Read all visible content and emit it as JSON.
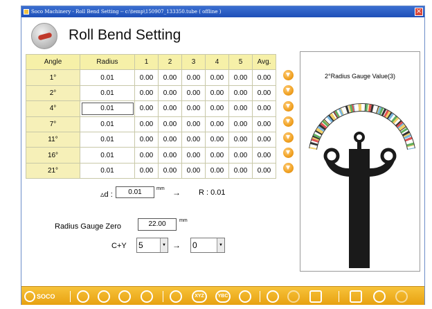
{
  "window": {
    "title": "Soco Machinery - Roll Bend Setting  -- c:\\temp\\150907_133350.tube ( offline )",
    "close_symbol": "×"
  },
  "page": {
    "title": "Roll Bend Setting"
  },
  "table": {
    "headers": [
      "Angle",
      "Radius",
      "1",
      "2",
      "3",
      "4",
      "5",
      "Avg."
    ],
    "rows": [
      {
        "angle": "1°",
        "radius": "0.01",
        "v1": "0.00",
        "v2": "0.00",
        "v3": "0.00",
        "v4": "0.00",
        "v5": "0.00",
        "avg": "0.00"
      },
      {
        "angle": "2°",
        "radius": "0.01",
        "v1": "0.00",
        "v2": "0.00",
        "v3": "0.00",
        "v4": "0.00",
        "v5": "0.00",
        "avg": "0.00"
      },
      {
        "angle": "4°",
        "radius": "0.01",
        "v1": "0.00",
        "v2": "0.00",
        "v3": "0.00",
        "v4": "0.00",
        "v5": "0.00",
        "avg": "0.00"
      },
      {
        "angle": "7°",
        "radius": "0.01",
        "v1": "0.00",
        "v2": "0.00",
        "v3": "0.00",
        "v4": "0.00",
        "v5": "0.00",
        "avg": "0.00"
      },
      {
        "angle": "11°",
        "radius": "0.01",
        "v1": "0.00",
        "v2": "0.00",
        "v3": "0.00",
        "v4": "0.00",
        "v5": "0.00",
        "avg": "0.00"
      },
      {
        "angle": "16°",
        "radius": "0.01",
        "v1": "0.00",
        "v2": "0.00",
        "v3": "0.00",
        "v4": "0.00",
        "v5": "0.00",
        "avg": "0.00"
      },
      {
        "angle": "21°",
        "radius": "0.01",
        "v1": "0.00",
        "v2": "0.00",
        "v3": "0.00",
        "v4": "0.00",
        "v5": "0.00",
        "avg": "0.00"
      }
    ]
  },
  "delta": {
    "label": "▵d :",
    "value": "0.01",
    "unit": "mm",
    "arrow": "→",
    "result": "R :  0.01"
  },
  "radius_gauge_zero": {
    "label": "Radius Gauge Zero",
    "value": "22.00",
    "unit": "mm"
  },
  "cy": {
    "label": "C+Y",
    "from_value": "5",
    "arrow": "→",
    "to_value": "0"
  },
  "gauge": {
    "title": "2°Radius Gauge Value(3)"
  },
  "toolbar": {
    "brand": "SOCO",
    "xyz": "XYZ",
    "ybc": "YBC"
  },
  "colors": {
    "header_fill": "#f6f0a8",
    "toolbar": "#f0b22a",
    "title_bar": "#2a5cc4",
    "gauge_arm": "#1a1a1a"
  }
}
